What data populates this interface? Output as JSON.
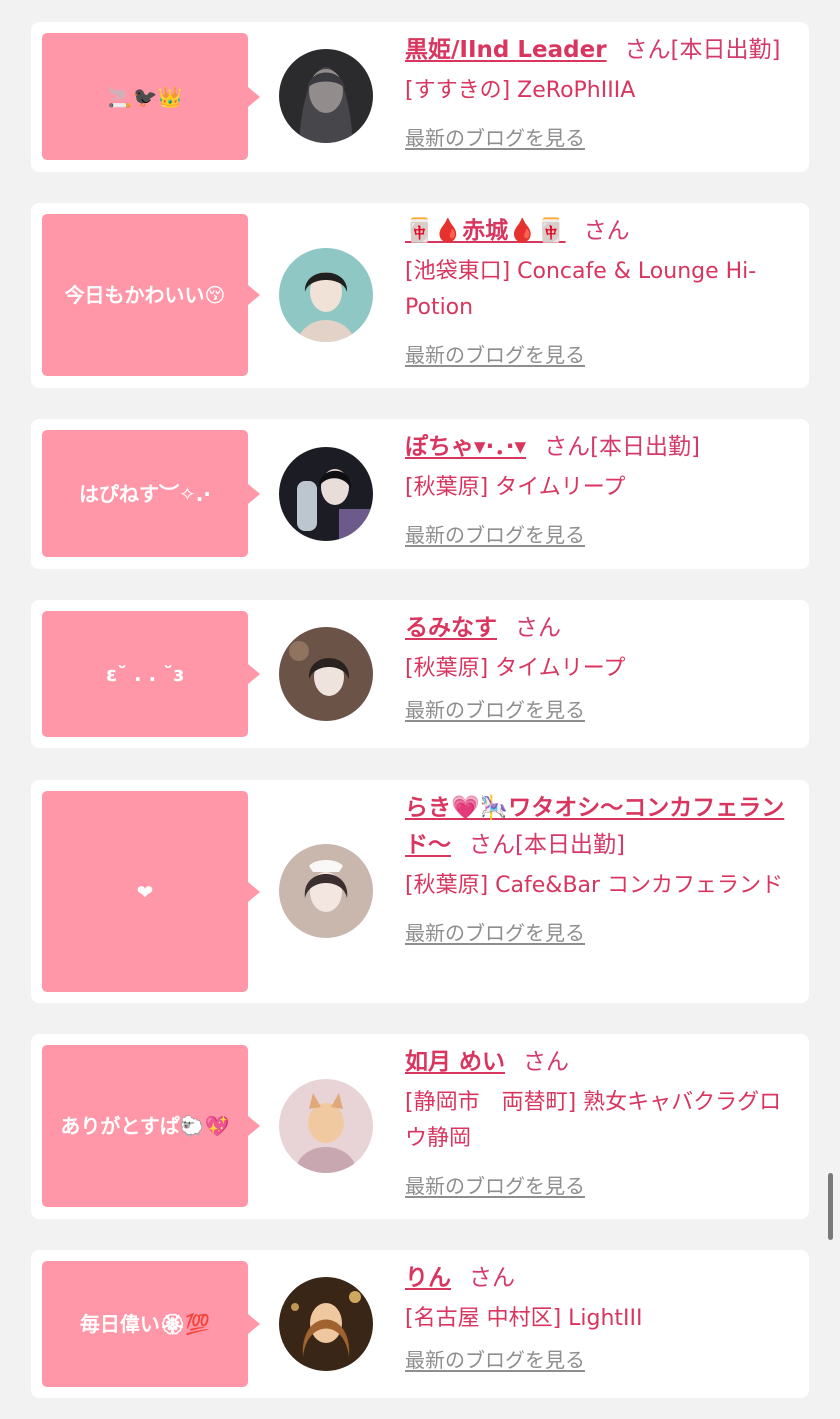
{
  "cards": [
    {
      "message": "🚬🐦‍⬛👑",
      "name": "黒姫/IInd Leader",
      "san": "さん",
      "status": "[本日出勤]",
      "shop": "[すすきの] ZeRoPhIIIA",
      "blog": "最新のブログを見る",
      "avatar_colors": [
        "#2b2b2e",
        "#e8d7cf",
        "#5a5a5f"
      ]
    },
    {
      "message": "今日もかわいい😚",
      "name": "🀄🩸赤城🩸🀄",
      "san": "さん",
      "status": "",
      "shop": "[池袋東口] Concafe & Lounge Hi-Potion",
      "blog": "最新のブログを見る",
      "avatar_colors": [
        "#8fc7c4",
        "#f1e2d8",
        "#202020"
      ]
    },
    {
      "message": "はぴねす︶✧.·",
      "name": "ぽちゃ▾·．·▾",
      "san": "さん",
      "status": "[本日出勤]",
      "shop": "[秋葉原] タイムリープ",
      "blog": "最新のブログを見る",
      "avatar_colors": [
        "#1c1c24",
        "#e9ddd9",
        "#6b5a8a"
      ]
    },
    {
      "message": "ɛ˘ . . ˘ɜ",
      "name": "るみなす",
      "san": "さん",
      "status": "",
      "shop": "[秋葉原] タイムリープ",
      "blog": "最新のブログを見る",
      "avatar_colors": [
        "#6b5347",
        "#efe3de",
        "#2a2220"
      ]
    },
    {
      "message": "❤",
      "name": "らき💗🎠ワタオシ〜コンカフェランド〜",
      "san": "さん",
      "status": "[本日出勤]",
      "shop": "[秋葉原] Cafe&Bar コンカフェランド",
      "blog": "最新のブログを見る",
      "avatar_colors": [
        "#c9b7ad",
        "#f3e6e1",
        "#3a2e2e"
      ]
    },
    {
      "message": "ありがとすぱ🐑💖",
      "name": "如月 めい",
      "san": "さん",
      "status": "",
      "shop": "[静岡市　両替町] 熟女キャバクラグロウ静岡",
      "blog": "最新のブログを見る",
      "avatar_colors": [
        "#e8d4d6",
        "#f1c9a0",
        "#c8a7b0"
      ]
    },
    {
      "message": "毎日偉い🏵💯",
      "name": "りん",
      "san": "さん",
      "status": "",
      "shop": "[名古屋 中村区] LightIII",
      "blog": "最新のブログを見る",
      "avatar_colors": [
        "#3a2617",
        "#f0c8a0",
        "#a0622e"
      ]
    }
  ]
}
